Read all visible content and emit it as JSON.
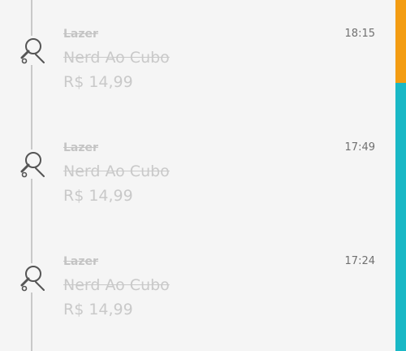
{
  "transactions": [
    {
      "category": "Lazer",
      "title": "Nerd Ao Cubo",
      "amount": "R$ 14,99",
      "time": "18:15",
      "icon": "ping-pong-paddle-icon"
    },
    {
      "category": "Lazer",
      "title": "Nerd Ao Cubo",
      "amount": "R$ 14,99",
      "time": "17:49",
      "icon": "ping-pong-paddle-icon"
    },
    {
      "category": "Lazer",
      "title": "Nerd Ao Cubo",
      "amount": "R$ 14,99",
      "time": "17:24",
      "icon": "ping-pong-paddle-icon"
    }
  ],
  "colors": {
    "side_bar": "#19b8c6",
    "side_bar_accent": "#f39c12",
    "muted_text": "#c9c9c9",
    "time_text": "#707070"
  }
}
